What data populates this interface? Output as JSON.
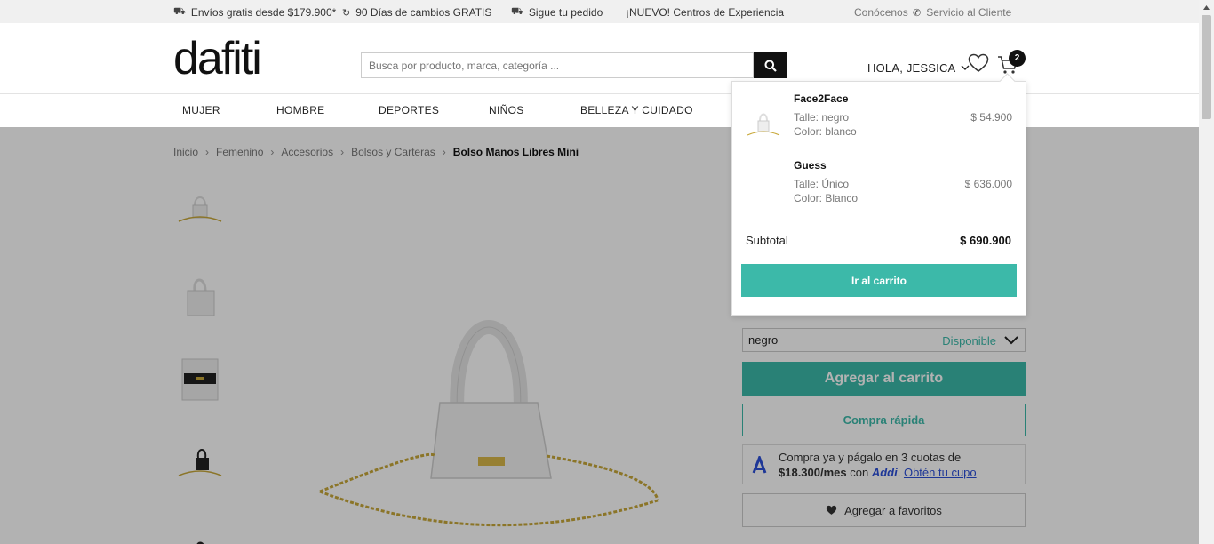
{
  "topbar": {
    "shipping": "Envíos gratis desde $179.900*",
    "returns": "90 Días de cambios GRATIS",
    "tracking": "Sigue tu pedido",
    "experience": "¡NUEVO! Centros de Experiencia",
    "about": "Conócenos",
    "service": "Servicio al Cliente"
  },
  "header": {
    "logo": "dafiti",
    "search_placeholder": "Busca por producto, marca, categoría ...",
    "greeting": "HOLA, JESSICA",
    "cart_count": "2"
  },
  "nav": [
    "MUJER",
    "HOMBRE",
    "DEPORTES",
    "NIÑOS",
    "BELLEZA Y CUIDADO"
  ],
  "breadcrumb": {
    "items": [
      "Inicio",
      "Femenino",
      "Accesorios",
      "Bolsos y Carteras"
    ],
    "current": "Bolso Manos Libres Mini"
  },
  "product": {
    "variant_value": "negro",
    "availability": "Disponible",
    "add_to_cart": "Agregar al carrito",
    "quick_buy": "Compra rápida",
    "addi_line1": "Compra ya y págalo en 3 cuotas de",
    "addi_amount": "$18.300/mes",
    "addi_with": "con",
    "addi_brand": "Addi",
    "addi_link": "Obtén tu cupo",
    "add_favorites": "Agregar a favoritos"
  },
  "cart": {
    "items": [
      {
        "brand": "Face2Face",
        "size": "Talle: negro",
        "color": "Color: blanco",
        "price": "$ 54.900"
      },
      {
        "brand": "Guess",
        "size": "Talle: Único",
        "color": "Color: Blanco",
        "price": "$ 636.000"
      }
    ],
    "subtotal_label": "Subtotal",
    "subtotal_value": "$ 690.900",
    "goto_label": "Ir al carrito"
  },
  "colors": {
    "accent": "#3cb9a9",
    "addi_blue": "#2c4fd8"
  }
}
